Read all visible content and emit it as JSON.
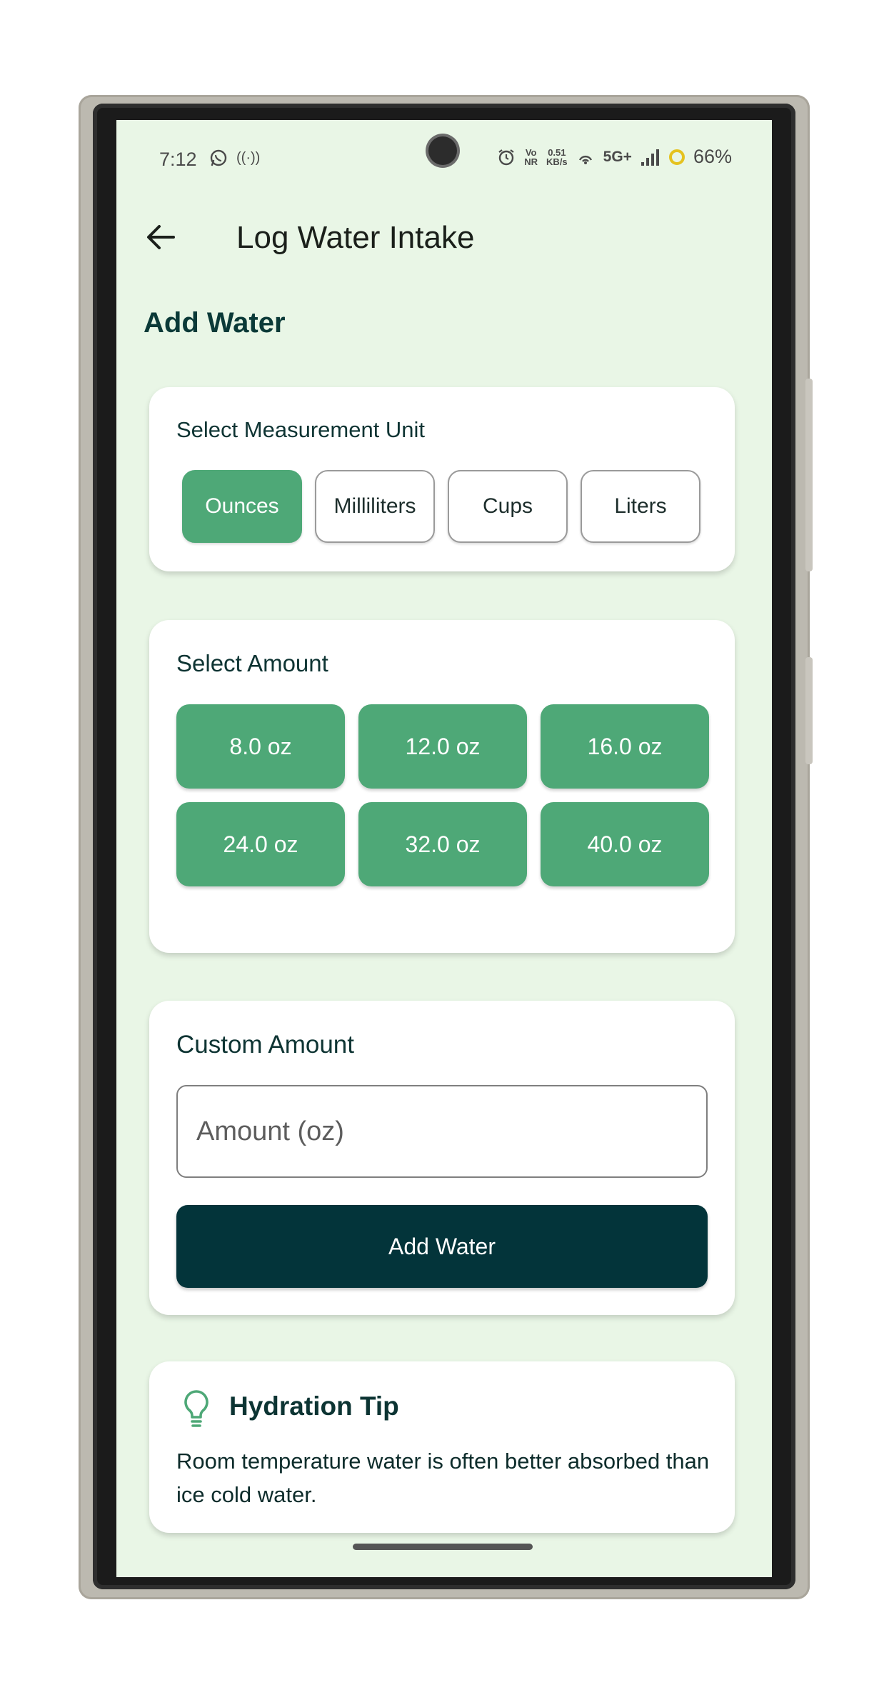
{
  "status_bar": {
    "time": "7:12",
    "hotspot_label": "((·))",
    "volte_label_top": "Vo",
    "volte_label_bottom": "NR",
    "speed_value": "0.51",
    "speed_unit": "KB/s",
    "network_label": "5G+",
    "battery_percent": "66%"
  },
  "app_bar": {
    "title": "Log Water Intake"
  },
  "page": {
    "section_title": "Add Water"
  },
  "units": {
    "label": "Select Measurement Unit",
    "options": [
      "Ounces",
      "Milliliters",
      "Cups",
      "Liters"
    ],
    "selected": "Ounces"
  },
  "amounts": {
    "label": "Select Amount",
    "options": [
      "8.0 oz",
      "12.0 oz",
      "16.0 oz",
      "24.0 oz",
      "32.0 oz",
      "40.0 oz"
    ]
  },
  "custom": {
    "label": "Custom Amount",
    "placeholder": "Amount (oz)",
    "value": "",
    "button_label": "Add Water"
  },
  "tip": {
    "title": "Hydration Tip",
    "text": "Room temperature water is often better absorbed than ice cold water."
  },
  "colors": {
    "screen_bg": "#e9f6e6",
    "primary_green": "#4ea877",
    "dark_teal": "#03343a",
    "card_bg": "#ffffff"
  }
}
